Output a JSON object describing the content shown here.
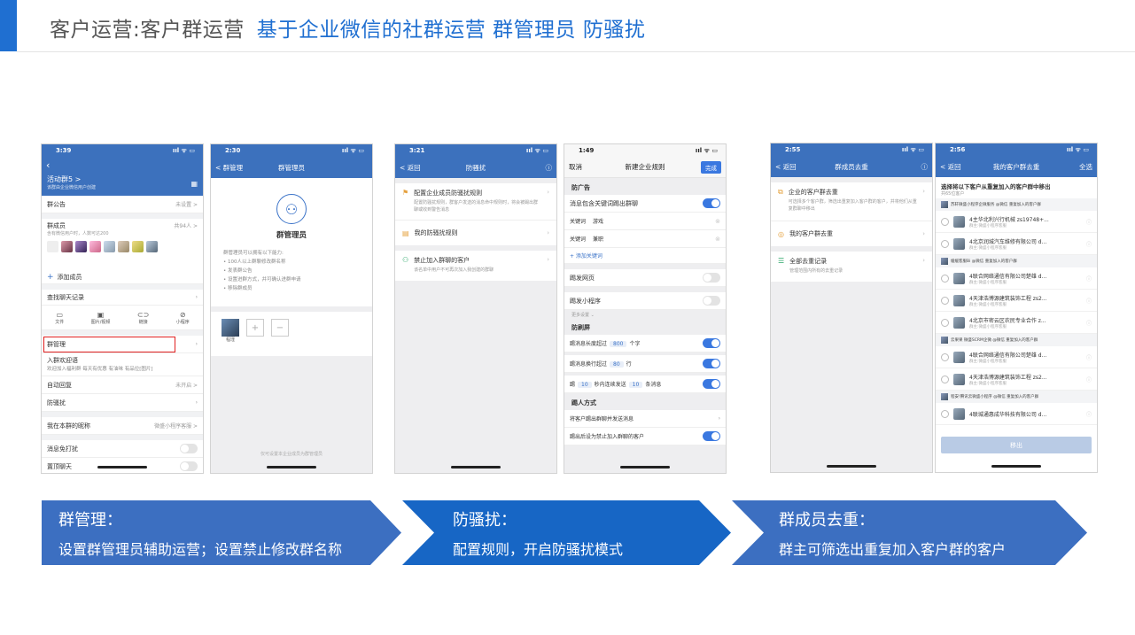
{
  "header": {
    "title_part1": "客户运营:客户群运营",
    "title_part2": "基于企业微信的社群运营 群管理员 防骚扰"
  },
  "phone1": {
    "time": "3:39",
    "signal": "ııl ᯤ ▭",
    "group_name": "活动群5 >",
    "group_sub": "该群由企业微信用户创建",
    "announcement": {
      "label": "群公告",
      "value": "未设置 >"
    },
    "members": {
      "label": "群成员",
      "count": "共94人 >",
      "sub": "含有微信用户时，人数可达200"
    },
    "add_member": "添加成员",
    "search_history": "查找聊天记录",
    "media": [
      "文件",
      "图片/视频",
      "链接",
      "小程序"
    ],
    "group_manage": "群管理",
    "welcome": {
      "label": "入群欢迎语",
      "sub": "欢迎加入福利群  每天有优惠  有油味  有品位[图片]"
    },
    "auto_reply": {
      "label": "自动回复",
      "value": "未开启 >"
    },
    "anti_harass": "防骚扰",
    "nickname": {
      "label": "我在本群的昵称",
      "value": "微盛小程序客服 >"
    },
    "mute": "消息免打扰",
    "pin": "置顶聊天"
  },
  "phone2": {
    "time": "2:30",
    "back": "< 群管理",
    "title": "群管理员",
    "role": "群管理员",
    "desc_title": "群管理员可以拥有以下能力:",
    "abilities": [
      "• 100人以上群聊修改群名称",
      "• 发表群公告",
      "• 设置进群方式，并可确认进群申请",
      "• 移除群成员"
    ],
    "admin_name": "程瑾",
    "footer": "仅可设置本企业成员为群管理员"
  },
  "phone3": {
    "time": "3:21",
    "back": "< 返回",
    "title": "防骚扰",
    "items": [
      {
        "label": "配置企业成员防骚扰规则",
        "sub": "配置防骚扰规则，群客户发送的消息命中规则时，将会被踢出群聊或收到警告消息"
      },
      {
        "label": "我的防骚扰规则",
        "sub": ""
      },
      {
        "label": "禁止加入群聊的客户",
        "sub": "该名单中用户不可再次加入我创建的群聊"
      }
    ]
  },
  "phone4": {
    "time": "1:49",
    "cancel": "取消",
    "title": "新建企业规则",
    "done": "完成",
    "sec_ads": "防广告",
    "keyword_kick": "消息包含关键词踢出群聊",
    "kw_label": "关键词",
    "kw1": "游戏",
    "kw2": "兼职",
    "add_kw": "+ 添加关键词",
    "kick_web": "踢发网页",
    "kick_mini": "踢发小程序",
    "more": "更多设置 ⌄",
    "sec_spam": "防刷屏",
    "len_pre": "踢消息长度超过",
    "len_val": "800",
    "len_post": "个字",
    "lines_pre": "踢消息换行超过",
    "lines_val": "80",
    "lines_post": "行",
    "cont_pre": "踢",
    "cont_val1": "10",
    "cont_mid": "秒内连续发送",
    "cont_val2": "10",
    "cont_post": "条消息",
    "sec_method": "踢人方式",
    "method1": "将客户踢出群聊并发送消息",
    "method2": "踢出后设为禁止加入群聊的客户"
  },
  "phone5": {
    "time": "2:55",
    "back": "< 返回",
    "title": "群成员去重",
    "items": [
      {
        "label": "企业的客户群去重",
        "sub": "可选择多个客户群，筛选出重复加入客户群的客户，并将他们从重复群聊中移出"
      },
      {
        "label": "我的客户群去重",
        "sub": ""
      },
      {
        "label": "全部去重记录",
        "sub": "管理范围内所有的去重记录"
      }
    ]
  },
  "phone6": {
    "time": "2:56",
    "back": "< 返回",
    "title": "我的客户群去重",
    "select_all": "全选",
    "heading": "选择将以下客户从重复加入的客户群中移出",
    "count": "共65位客户",
    "groups": [
      {
        "header": "苏轩微盛小程序企微服务 @微信 重复加入的客户群",
        "rows": [
          {
            "name": "4主华北利兴行机械 zs19748+...",
            "sub": "群主:微盛小程序客服"
          },
          {
            "name": "4北京润城汽车维修有限公司 d...",
            "sub": "群主:微盛小程序客服"
          }
        ]
      },
      {
        "header": "缓缓客服Bi @微信 重复加入的客户群",
        "rows": [
          {
            "name": "4联合网络通信有限公司楚雄 d...",
            "sub": "群主:微盛小程序客服"
          },
          {
            "name": "4天津浩博源建筑装饰工程 zs2...",
            "sub": "群主:微盛小程序客服"
          },
          {
            "name": "4北京市密云区农民专业合作 z...",
            "sub": "群主:微盛小程序客服"
          }
        ]
      },
      {
        "header": "云果果 微盛SCRM企微 @微信 重复加入的客户群",
        "rows": [
          {
            "name": "4联合网络通信有限公司楚雄 d...",
            "sub": "群主:微盛小程序客服"
          },
          {
            "name": "4天津浩博源建筑装饰工程 zs2...",
            "sub": "群主:微盛小程序客服"
          }
        ]
      },
      {
        "header": "程安!腾讯云微盛小程序 @微信 重复加入的客户群",
        "rows": [
          {
            "name": "4联城通惠成华科技有限公司 d...",
            "sub": ""
          }
        ]
      }
    ],
    "remove_btn": "移出"
  },
  "banners": [
    {
      "heading": "群管理：",
      "desc": "设置群管理员辅助运营；设置禁止修改群名称",
      "color": "#3c6fc1"
    },
    {
      "heading": "防骚扰：",
      "desc": "配置规则，开启防骚扰模式",
      "color": "#1766c5"
    },
    {
      "heading": "群成员去重：",
      "desc": "群主可筛选出重复加入客户群的客户",
      "color": "#3c6fc1"
    }
  ]
}
